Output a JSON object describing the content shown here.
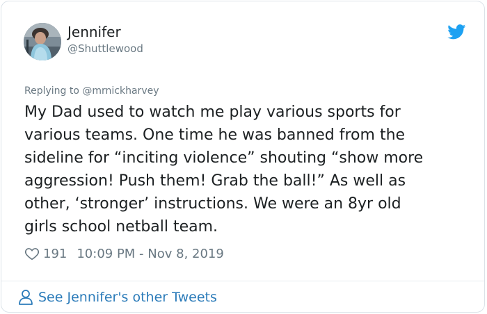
{
  "tweet": {
    "author_name": "Jennifer",
    "author_handle": "@Shuttlewood",
    "replying_to_prefix": "Replying to",
    "replying_to_handle": "@mrnickharvey",
    "text": "My Dad used to watch me play various sports for\nvarious teams. One time he was banned from the\nsideline for “inciting violence” shouting “show more\naggression! Push them! Grab the ball!” As well as\nother, ‘stronger’ instructions. We were an 8yr old\ngirls school netball team.",
    "likes": "191",
    "timestamp": "10:09 PM - Nov 8, 2019",
    "footer_link": "See Jennifer's other Tweets"
  },
  "icons": {
    "brand": "twitter-bird-icon",
    "like": "heart-icon",
    "profile": "person-icon"
  },
  "colors": {
    "brand_blue": "#1da1f2",
    "link_blue": "#2b7bb9",
    "text_primary": "#1c2022",
    "text_secondary": "#697882"
  }
}
